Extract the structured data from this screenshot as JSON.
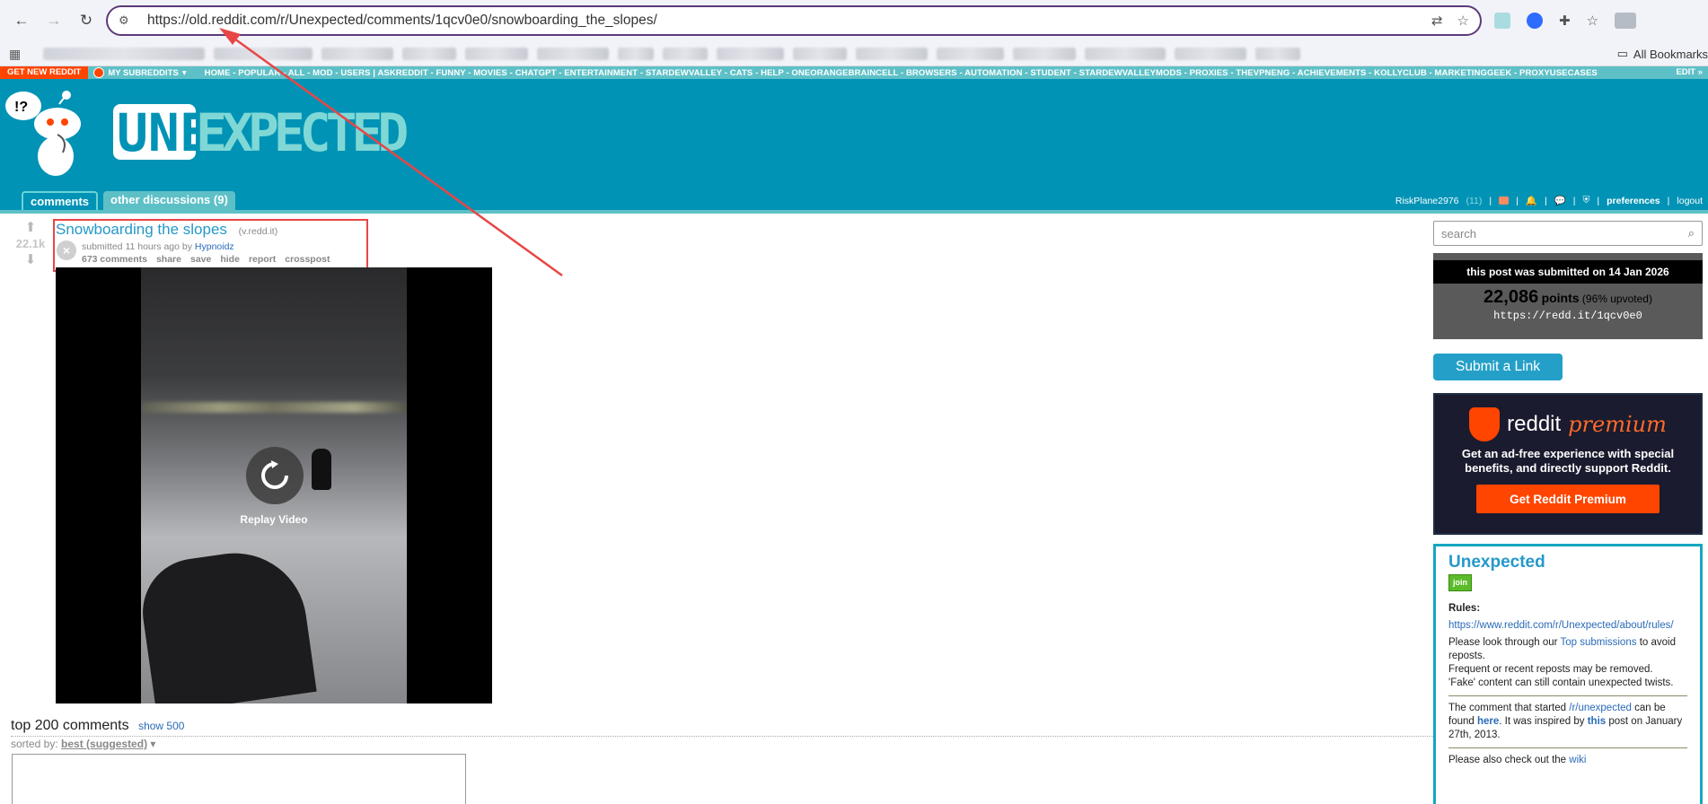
{
  "browser": {
    "url": "https://old.reddit.com/r/Unexpected/comments/1qcv0e0/snowboarding_the_slopes/",
    "all_bookmarks_label": "All Bookmarks"
  },
  "topbar": {
    "get_new": "GET NEW REDDIT",
    "my_subreddits": "MY SUBREDDITS",
    "links": "HOME - POPULAR - ALL - MOD - USERS  |  ASKREDDIT - FUNNY - MOVIES - CHATGPT - ENTERTAINMENT - STARDEWVALLEY - CATS - HELP - ONEORANGEBRAINCELL - BROWSERS - AUTOMATION - STUDENT - STARDEWVALLEYMODS - PROXIES - THEVPNENG - ACHIEVEMENTS - KOLLYCLUB - MARKETINGGEEK - PROXYUSECASES",
    "edit": "EDIT »"
  },
  "header": {
    "banner_text": "UNEXPECTED",
    "tab_comments": "comments",
    "tab_other": "other discussions (9)",
    "username": "RiskPlane2976",
    "karma": "(11)",
    "preferences": "preferences",
    "logout": "logout"
  },
  "post": {
    "score": "22.1k",
    "title": "Snowboarding the slopes",
    "domain": "(v.redd.it)",
    "tagline_prefix": "submitted 11 hours ago by",
    "author": "Hypnoidz",
    "buttons": [
      "673 comments",
      "share",
      "save",
      "hide",
      "report",
      "crosspost"
    ],
    "replay": "Replay Video"
  },
  "comments": {
    "title": "top 200 comments",
    "show": "show 500",
    "sorted_prefix": "sorted by:",
    "sort": "best (suggested)"
  },
  "sidebar": {
    "search_placeholder": "search",
    "submitted_on": "this post was submitted on 14 Jan 2026",
    "points": "22,086",
    "points_label": "points",
    "upvoted": "(96% upvoted)",
    "shortlink": "https://redd.it/1qcv0e0",
    "submit_link": "Submit a Link",
    "premium_word": "reddit",
    "premium_suffix": "premium",
    "premium_text": "Get an ad-free experience with special benefits, and directly support Reddit.",
    "premium_button": "Get Reddit Premium",
    "sr_name": "Unexpected",
    "join": "join",
    "rules_label": "Rules:",
    "rules_url": "https://www.reddit.com/r/Unexpected/about/rules/",
    "p1_a": "Please look through our",
    "p1_link": "Top submissions",
    "p1_b": "to avoid reposts.",
    "p2": "Frequent or recent reposts may be removed.",
    "p3": "'Fake' content can still contain unexpected twists.",
    "p4_a": "The comment that started",
    "p4_link1": "/r/unexpected",
    "p4_b": "can be found",
    "p4_link2": "here",
    "p4_c": ". It was inspired by",
    "p4_link3": "this",
    "p4_d": "post on January 27th, 2013.",
    "p5_a": "Please also check out the",
    "p5_link": "wiki"
  },
  "colors": {
    "header_bg": "#0093b5",
    "accent": "#5ec0c7",
    "highlight_box": "#e84646",
    "premium_orange": "#ff4500"
  }
}
